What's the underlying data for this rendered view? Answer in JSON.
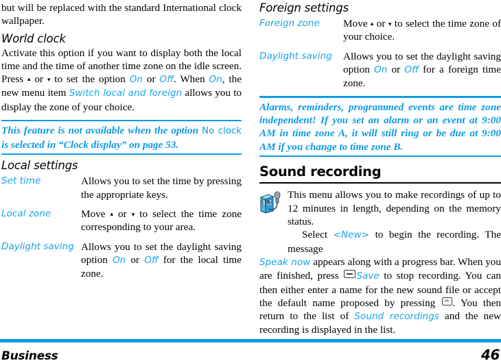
{
  "document": {
    "footer": {
      "chapter": "Business",
      "page_number": "46",
      "accent_color": "#009FE3"
    },
    "accent_color": "#1AA3E8"
  },
  "left_column": {
    "continuation_paragraph": "but will be replaced with the standard International clock wallpaper.",
    "world_clock": {
      "heading": "World clock",
      "paragraph_part1": "Activate this option if you want to display both the local time and the time of another time zone on the idle screen. Press ",
      "arrow_up": "▴",
      "paragraph_or1": " or ",
      "arrow_down": "▾",
      "paragraph_part2": " to set the option ",
      "option_on": "On",
      "paragraph_or2": " or ",
      "option_off": "Off",
      "paragraph_part3": ". When ",
      "option_on2": "On",
      "paragraph_part4": ", the new menu item ",
      "menu_item": "Switch local and foreign",
      "paragraph_part5": " allows you to display the zone of your choice."
    },
    "note": {
      "text_part1": "This feature is not available when the option ",
      "highlight1": "No clock",
      "text_part2": " is selected in “Clock display” on page 53."
    },
    "local_settings": {
      "heading": "Local settings",
      "rows": [
        {
          "term": "Set time",
          "definition": "Allows you to set the time by pressing the appropriate keys."
        },
        {
          "term": "Local zone",
          "def_part1": "Move ",
          "arrow_up": "▴",
          "def_or": " or ",
          "arrow_down": "▾",
          "def_part2": " to select the time zone corresponding to your area."
        },
        {
          "term": "Daylight saving",
          "def_part1": "Allows you to set the daylight saving option ",
          "option_on": "On",
          "def_or": " or ",
          "option_off": "Off",
          "def_part2": " for the local time zone."
        }
      ]
    }
  },
  "right_column": {
    "foreign_settings": {
      "heading": "Foreign settings",
      "rows": [
        {
          "term": "Foreign zone",
          "def_part1": "Move ",
          "arrow_up": "▴",
          "def_or": " or ",
          "arrow_down": "▾",
          "def_part2": " to select the time zone of your choice."
        },
        {
          "term": "Daylight saving",
          "def_part1": "Allows you to set the daylight saving option ",
          "option_on": "On",
          "def_or": " or ",
          "option_off": "Off",
          "def_part2": " for a foreign time zone."
        }
      ]
    },
    "note": {
      "text": "Alarms, reminders, programmed events are time zone independent! If you set an alarm or an event at 9:00 AM in time zone A, it will still ring or be due at 9:00 AM if you change to time zone B."
    },
    "sound_recording": {
      "heading": "Sound recording",
      "icon_name": "tape-recorder-microphone-icon",
      "intro": "This menu allows you to make recordings of up to 12 minutes in length, depending on the memory status.",
      "body_part1": "Select ",
      "new_item": "<New>",
      "body_part2": " to begin the recording. The message ",
      "speak_now": "Speak now",
      "body_part3": " appears along with a progress bar. When you are finished, press ",
      "softkey_label": "",
      "save_label": "Save",
      "body_part4": " to stop recording. You can then either enter a name for the new sound file or accept the default name proposed by pressing ",
      "ok_key_label": "ok",
      "body_part5": ". You then return to the list of ",
      "sound_recordings": "Sound recordings",
      "body_part6": " and the new recording is displayed in the list."
    }
  }
}
